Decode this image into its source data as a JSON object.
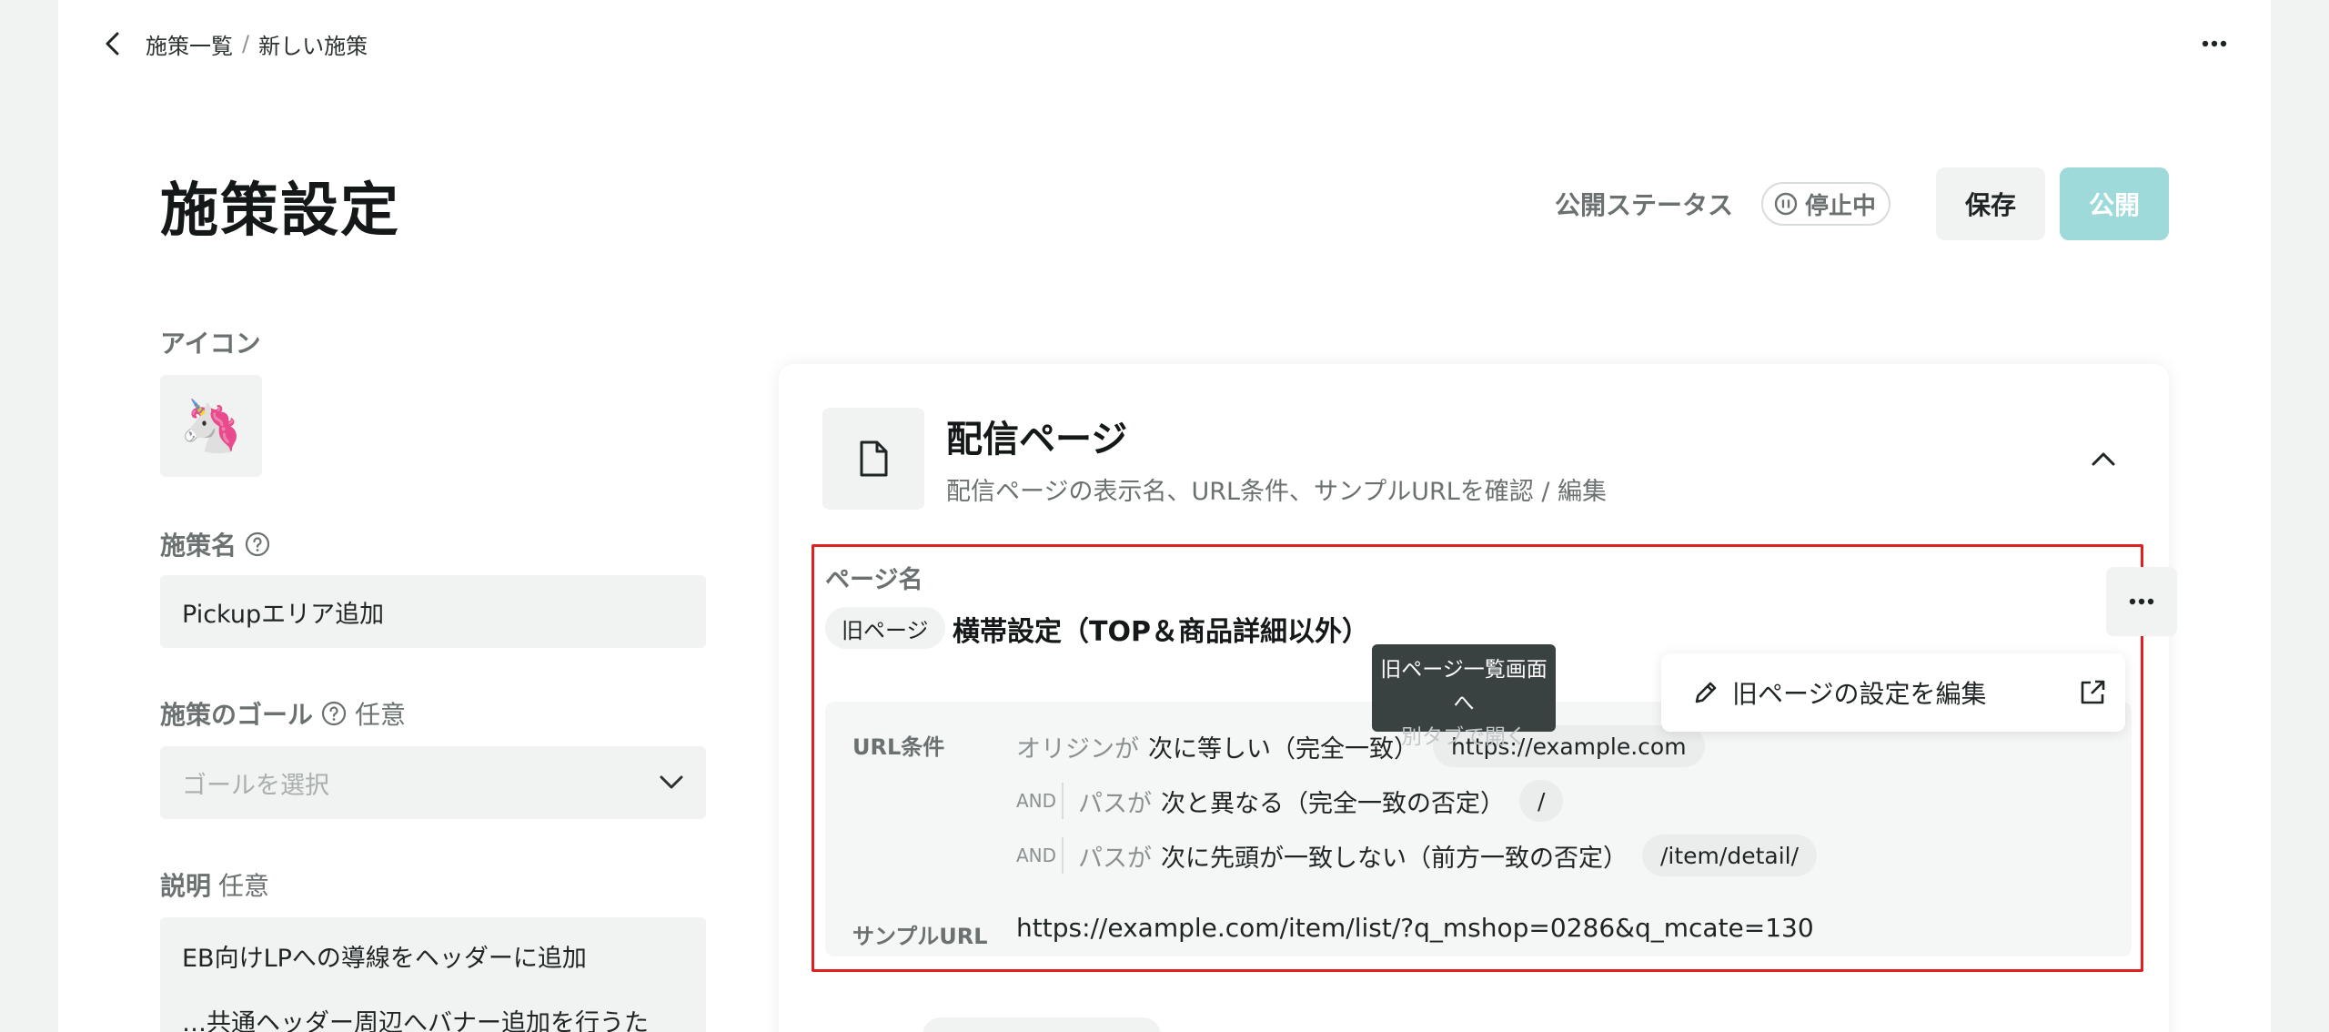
{
  "breadcrumb": {
    "parent": "施策一覧",
    "separator": "/",
    "current": "新しい施策"
  },
  "page_title": "施策設定",
  "header": {
    "status_label": "公開ステータス",
    "status_value": "停止中",
    "save_label": "保存",
    "publish_label": "公開"
  },
  "form": {
    "icon_label": "アイコン",
    "icon_emoji": "🦄",
    "name_label": "施策名",
    "name_value": "Pickupエリア追加",
    "goal_label": "施策のゴール",
    "goal_optional": "任意",
    "goal_placeholder": "ゴールを選択",
    "description_label": "説明",
    "description_optional": "任意",
    "description_line1": "EB向けLPへの導線をヘッダーに追加",
    "description_line2": "…共通ヘッダー周辺へバナー追加を行うため…"
  },
  "delivery_card": {
    "title": "配信ページ",
    "subtitle": "配信ページの表示名、URL条件、サンプルURLを確認 / 編集",
    "page_name_label": "ページ名",
    "old_page_badge": "旧ページ",
    "page_name": "横帯設定（TOP＆商品詳細以外）",
    "url_conditions_label": "URL条件",
    "conditions": [
      {
        "connector": "",
        "subject": "オリジンが",
        "operator": "次に等しい（完全一致）",
        "value": "https://example.com"
      },
      {
        "connector": "AND",
        "subject": "パスが",
        "operator": "次と異なる（完全一致の否定）",
        "value": "/"
      },
      {
        "connector": "AND",
        "subject": "パスが",
        "operator": "次に先頭が一致しない（前方一致の否定）",
        "value": "/item/detail/"
      }
    ],
    "sample_url_label": "サンプルURL",
    "sample_url": "https://example.com/item/list/?q_mshop=0286&q_mcate=130"
  },
  "menu": {
    "edit_old_page": "旧ページの設定を編集"
  },
  "tooltip": {
    "line1": "旧ページ一覧画面へ",
    "line2": "別タブで開く"
  },
  "colors": {
    "accent_disabled": "#9fdadb",
    "highlight_border": "#e0201e",
    "tooltip_bg": "#3a4141"
  }
}
